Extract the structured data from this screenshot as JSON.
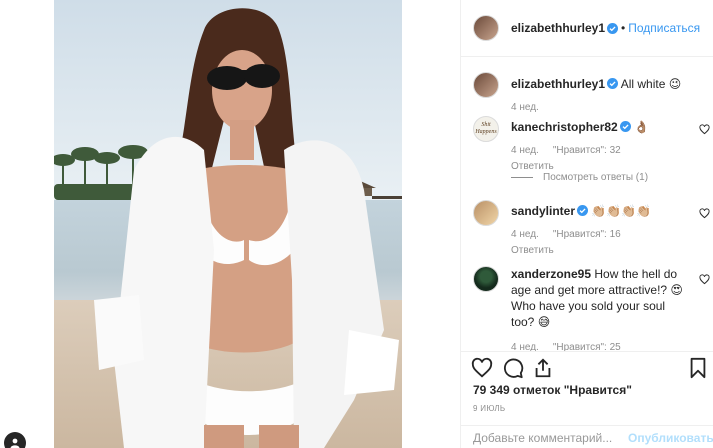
{
  "header": {
    "username": "elizabethhurley1",
    "separator": "•",
    "follow_label": "Подписаться"
  },
  "comments": [
    {
      "username": "elizabethhurley1",
      "text": "All white 😉",
      "time": "4 нед.",
      "likes": "",
      "reply": ""
    },
    {
      "username": "kanechristopher82",
      "text": "👌🏽",
      "time": "4 нед.",
      "likes": "\"Нравится\": 32",
      "reply": "Ответить",
      "view_replies": "Посмотреть ответы (1)"
    },
    {
      "username": "sandylinter",
      "text": "👏🏼👏🏼👏🏼👏🏼",
      "time": "4 нед.",
      "likes": "\"Нравится\": 16",
      "reply": "Ответить"
    },
    {
      "username": "xanderzone95",
      "text": "How the hell do age and get more attractive!? 😍 Who have you sold your soul too? 😅",
      "time": "4 нед.",
      "likes": "\"Нравится\": 25",
      "reply": ""
    }
  ],
  "avatar_text": {
    "shit": "Shit Happens"
  },
  "actions": {
    "likes_text": "79 349 отметок \"Нравится\"",
    "date": "9 ИЮЛЬ"
  },
  "composer": {
    "placeholder": "Добавьте комментарий...",
    "publish_label": "Опубликовать"
  },
  "colors": {
    "accent": "#3897f0",
    "publish_disabled": "#b2dffc",
    "muted": "#8e8e8e"
  }
}
